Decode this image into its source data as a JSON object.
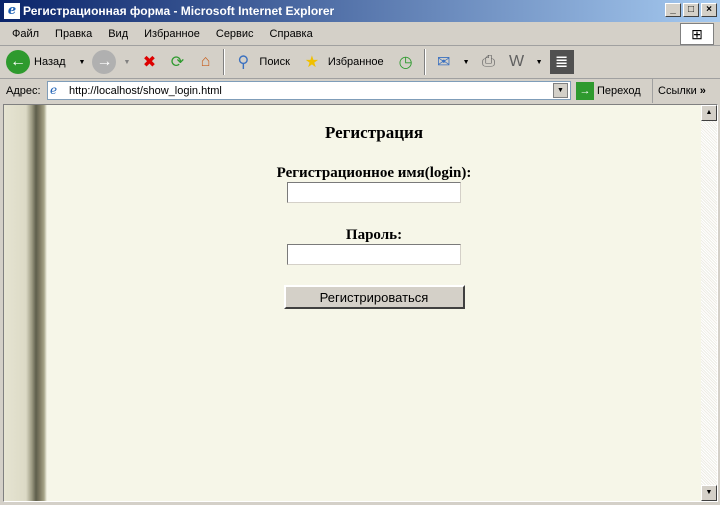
{
  "window": {
    "title": "Регистрационная форма - Microsoft Internet Explorer"
  },
  "menu": [
    "Файл",
    "Правка",
    "Вид",
    "Избранное",
    "Сервис",
    "Справка"
  ],
  "toolbar": {
    "back": "Назад",
    "search": "Поиск",
    "favorites": "Избранное"
  },
  "address": {
    "label": "Адрес:",
    "url": "http://localhost/show_login.html",
    "go": "Переход",
    "links": "Ссылки"
  },
  "page": {
    "heading": "Регистрация",
    "login_label": "Регистрационное имя(login):",
    "login_value": "",
    "password_label": "Пароль:",
    "password_value": "",
    "submit": "Регистрироваться"
  }
}
